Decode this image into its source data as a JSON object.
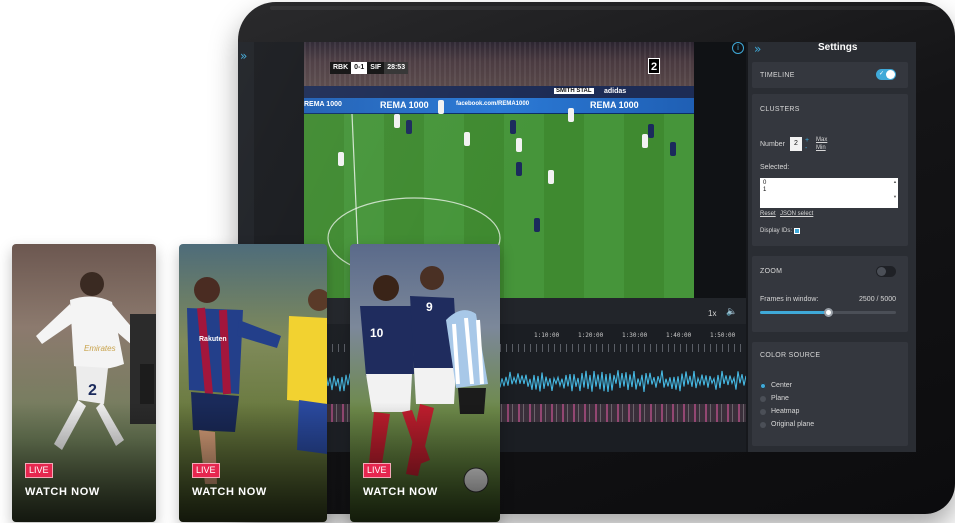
{
  "video": {
    "scoreboard": {
      "home": "RBK",
      "score": "0-1",
      "away": "SIF",
      "time": "28:53"
    },
    "channel": "2",
    "ads": {
      "brand1": "REMA 1000",
      "facebook": "facebook.com/REMA1000",
      "brand2": "REMA 1000",
      "smith": "SMITH STAL",
      "adidas": "adidas"
    },
    "speed": "1x"
  },
  "timeline": {
    "ticks": [
      "1:10:00",
      "1:20:00",
      "1:30:00",
      "1:40:00",
      "1:50:00"
    ]
  },
  "settings": {
    "title": "Settings",
    "timeline": {
      "label": "TIMELINE",
      "enabled": true
    },
    "clusters": {
      "label": "CLUSTERS",
      "number_label": "Number",
      "number_value": "2",
      "max_label": "Max",
      "min_label": "Min",
      "selected_label": "Selected:",
      "selected_values": [
        "0",
        "1"
      ],
      "reset_label": "Reset",
      "json_label": "JSON select",
      "display_ids_label": "Display IDs:"
    },
    "zoom": {
      "label": "ZOOM",
      "enabled": false,
      "frames_label": "Frames in window:",
      "frames_value": "2500 / 5000",
      "frames_fraction": 0.5
    },
    "color_source": {
      "label": "COLOR SOURCE",
      "options": [
        "Center",
        "Plane",
        "Heatmap",
        "Original plane"
      ],
      "selected": "Center"
    }
  },
  "cards": [
    {
      "badge": "LIVE",
      "action": "WATCH NOW",
      "jersey": "2",
      "crest": "Emirates"
    },
    {
      "badge": "LIVE",
      "action": "WATCH NOW",
      "crest": "Rakuten"
    },
    {
      "badge": "LIVE",
      "action": "WATCH NOW",
      "jersey": "10",
      "jersey2": "9"
    }
  ],
  "colors": {
    "accent": "#3fa9d8",
    "live_badge": "#e6264f",
    "panel": "#2a2d33",
    "card": "#34373e"
  }
}
